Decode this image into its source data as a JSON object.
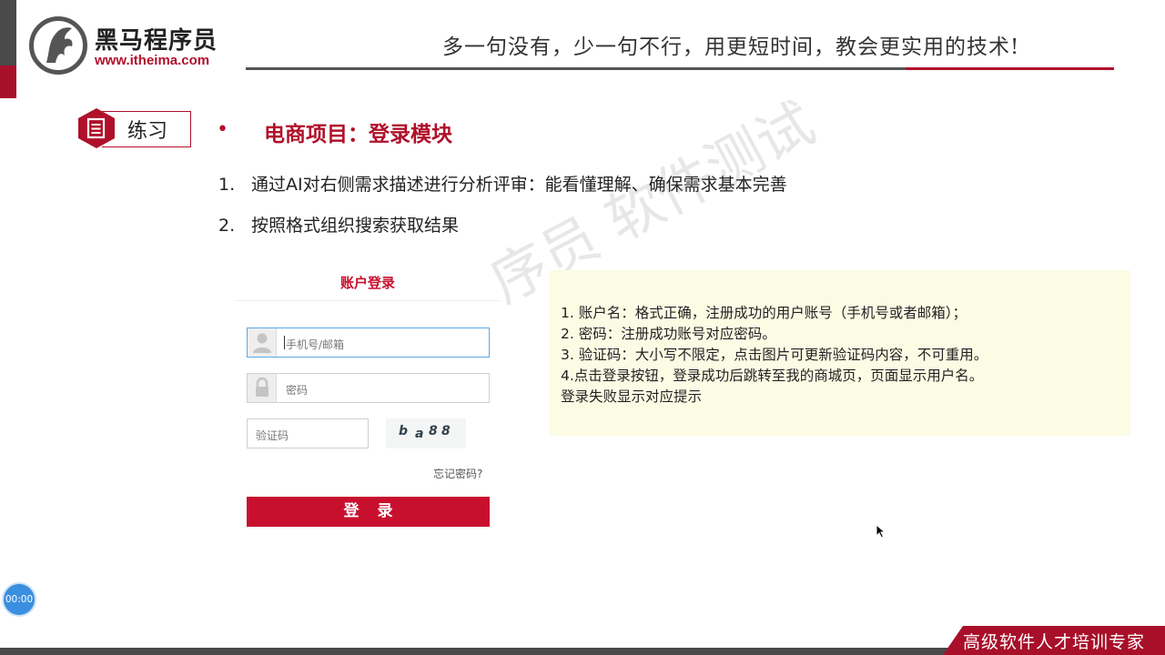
{
  "header": {
    "brand_name": "黑马程序员",
    "brand_url": "www.itheima.com",
    "slogan": "多一句没有，少一句不行，用更短时间，教会更实用的技术!"
  },
  "section": {
    "exercise_label": "练习",
    "bullet": "•",
    "title": "电商项目：登录模块"
  },
  "tasks": [
    {
      "num": "1.",
      "text": "通过AI对右侧需求描述进行分析评审：能看懂理解、确保需求基本完善"
    },
    {
      "num": "2.",
      "text": "按照格式组织搜索获取结果"
    }
  ],
  "watermark": "序员 软件测试",
  "login_form": {
    "title": "账户登录",
    "username_placeholder": "手机号/邮箱",
    "password_placeholder": "密码",
    "captcha_placeholder": "验证码",
    "captcha_chars": [
      "b",
      "a",
      "8",
      "8"
    ],
    "forgot_link": "忘记密码?",
    "submit_label": "登录"
  },
  "requirements": [
    "1. 账户名：格式正确，注册成功的用户账号（手机号或者邮箱）；",
    "2. 密码：注册成功账号对应密码。",
    "3. 验证码：大小写不限定，点击图片可更新验证码内容，不可重用。",
    "4.点击登录按钮，登录成功后跳转至我的商城页，页面显示用户名。",
    "登录失败显示对应提示"
  ],
  "timer": "00:00",
  "footer": {
    "tagline": "高级软件人才培训专家"
  },
  "colors": {
    "brand_red": "#b0102a",
    "button_red": "#c8102e",
    "panel_bg": "#fcfce5",
    "timer_blue": "#3b8fe0"
  }
}
